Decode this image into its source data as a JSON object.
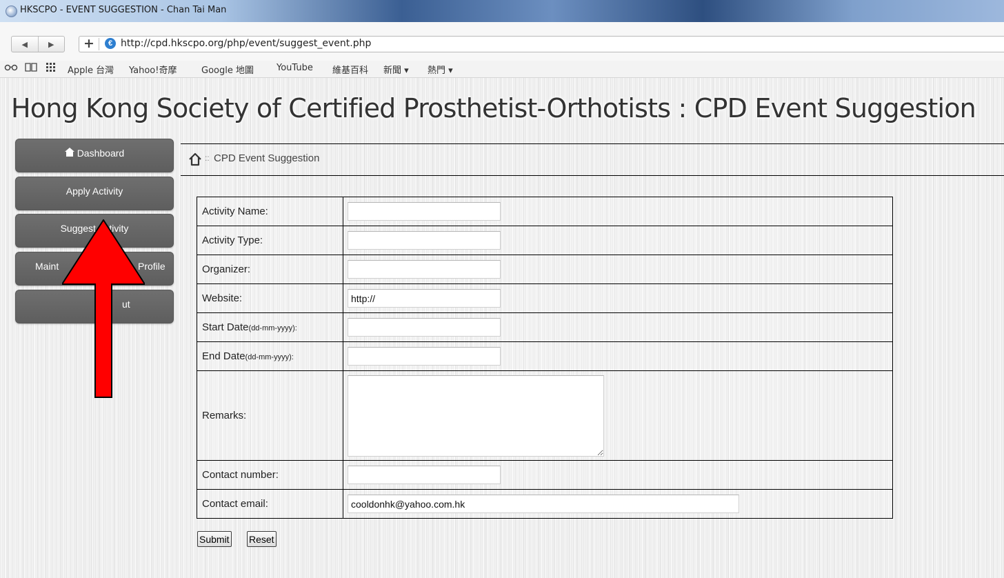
{
  "window": {
    "title": "HKSCPO - EVENT SUGGESTION - Chan Tai Man"
  },
  "toolbar": {
    "back_glyph": "◀",
    "forward_glyph": "▶",
    "add_glyph": "+",
    "url": "http://cpd.hkscpo.org/php/event/suggest_event.php"
  },
  "bookmarks": {
    "icons": [
      "reader-glasses-icon",
      "book-icon",
      "grid-icon"
    ],
    "items": [
      "Apple 台灣",
      "Yahoo!奇摩",
      "Google 地圖",
      "YouTube",
      "維基百科",
      "新聞 ▾",
      "熱門 ▾"
    ]
  },
  "page": {
    "title": "Hong Kong Society of Certified Prosthetist-Orthotists : CPD Event Suggestion"
  },
  "sidebar": {
    "items": [
      {
        "label": "Dashboard",
        "icon": "home-icon"
      },
      {
        "label": "Apply Activity"
      },
      {
        "label": "Suggest Activity"
      },
      {
        "label": "Maint",
        "label_tail": "Profile"
      },
      {
        "label": "ut"
      }
    ]
  },
  "breadcrumb": {
    "separator": "::",
    "current": "CPD Event Suggestion"
  },
  "form": {
    "activity_name": {
      "label": "Activity Name:",
      "value": ""
    },
    "activity_type": {
      "label": "Activity Type:",
      "value": ""
    },
    "organizer": {
      "label": "Organizer:",
      "value": ""
    },
    "website": {
      "label": "Website:",
      "value": "http://"
    },
    "start_date": {
      "label": "Start Date",
      "hint": "(dd-mm-yyyy):",
      "value": ""
    },
    "end_date": {
      "label": "End Date",
      "hint": "(dd-mm-yyyy):",
      "value": ""
    },
    "remarks": {
      "label": "Remarks:",
      "value": ""
    },
    "contact_number": {
      "label": "Contact number:",
      "value": ""
    },
    "contact_email": {
      "label": "Contact email:",
      "value": "cooldonhk@yahoo.com.hk"
    },
    "submit_label": "Submit",
    "reset_label": "Reset"
  },
  "annotation": {
    "arrow_color": "#ff0000",
    "points_to": "Suggest Activity"
  }
}
